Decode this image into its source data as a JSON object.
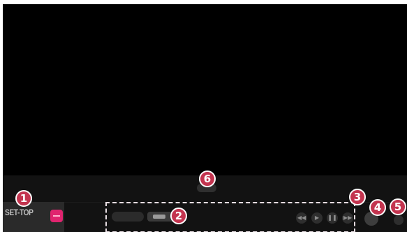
{
  "source": {
    "label": "SET-TOP"
  },
  "media_controls": {
    "rewind_icon": "rewind-icon",
    "play_icon": "play-icon",
    "pause_icon": "pause-icon",
    "forward_icon": "fast-forward-icon"
  },
  "callouts": [
    "1",
    "2",
    "3",
    "4",
    "5",
    "6"
  ],
  "colors": {
    "badge": "#c3344f",
    "accent": "#e0246f",
    "screen": "#000000",
    "dashed_border": "#e7dde2"
  }
}
